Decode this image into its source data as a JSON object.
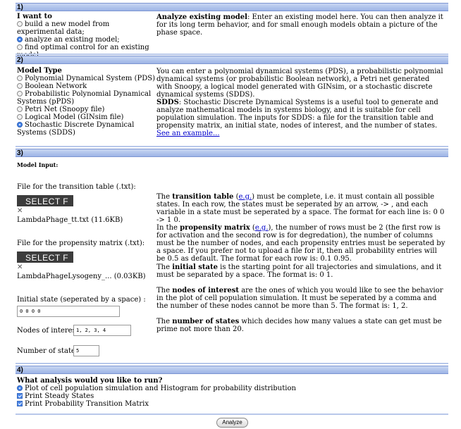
{
  "section1": {
    "num": "1)",
    "heading": "I want to",
    "options": [
      {
        "label": "build a new model from experimental data;",
        "selected": false
      },
      {
        "label": "analyze an existing model;",
        "selected": true
      },
      {
        "label": "find optimal control for an existing model.",
        "selected": false
      }
    ],
    "desc_bold": "Analyze existing model",
    "desc_text": ": Enter an existing model here. You can then analyze it for its long term behavior, and for small enough models obtain a picture of the phase space."
  },
  "section2": {
    "num": "2)",
    "heading": "Model Type",
    "options": [
      {
        "label": "Polynomial Dynamical System (PDS)",
        "selected": false
      },
      {
        "label": "Boolean Network",
        "selected": false
      },
      {
        "label": "Probabilistic Polynomial Dynamical Systems (pPDS)",
        "selected": false
      },
      {
        "label": "Petri Net (Snoopy file)",
        "selected": false
      },
      {
        "label": "Logical Model (GINsim file)",
        "selected": false
      },
      {
        "label": "Stochastic Discrete Dynamical Systems (SDDS)",
        "selected": true
      }
    ],
    "desc1": "You can enter a polynomial dynamical systems (PDS), a probabilistic polynomial dynamical systems (or probabilistic Boolean network), a Petri net generated with Snoopy, a logical model generated with GINsim, or a stochastic discrete dynamical systems (SDDS).",
    "desc2_bold": "SDDS",
    "desc2_text": ": Stochastic Discrete Dynamical Systems is a useful tool to generate and analyze mathematical models in systems biology, and it is suitable for cell population simulation. The inputs for SDDS: a file for the transition table and propensity matrix, an initial state, nodes of interest, and the number of states.",
    "example_link": "See an example..."
  },
  "section3": {
    "num": "3)",
    "heading": "Model Input:",
    "transition_label": "File for the transition table (.txt):",
    "select_label": "SELECT F",
    "transition_file": "LambdaPhage_tt.txt (11.6KB)",
    "propensity_label": "File for the propensity matrix (.txt):",
    "propensity_file": "LambdaPhageLysogeny_... (0.03KB)",
    "initial_label": "Initial state (seperated by a space) :",
    "initial_value": "0 0 0 0",
    "nodes_label": "Nodes of interest :",
    "nodes_value": "1, 2, 3, 4",
    "states_label": "Number of states :",
    "states_value": "5",
    "eg": "e.g.",
    "tt_pre": "The ",
    "tt_bold": "transition table",
    "tt_mid": " (",
    "tt_post": ") must be complete, i.e. it must contain all possible states. In each row, the states must be seperated by an arrow, -> , and each variable in a state must be seperated by a space. The format for each line is: 0 0 -> 1 0.",
    "pm_pre": "In the ",
    "pm_bold": "propensity matrix",
    "pm_mid": " (",
    "pm_post": "), the number of rows must be 2 (the first row is for activation and the second row is for degredation), the number of columns must be the number of nodes, and each propensity entries must be seperated by a space. If you prefer not to upload a file for it, then all probability entries will be 0.5 as default. The format for each row is: 0.1 0.95.",
    "is_pre": "The ",
    "is_bold": "initial state",
    "is_post": " is the starting point for all trajectories and simulations, and it must be separated by a space. The format is: 0 1.",
    "ni_pre": "The ",
    "ni_bold": "nodes of interest",
    "ni_post": " are the ones of which you would like to see the behavior in the plot of cell population simulation. It must be seperated by a comma and the number of these nodes cannot be more than 5. The format is: 1, 2.",
    "ns_pre": "The ",
    "ns_bold": "number of states",
    "ns_post": " which decides how many values a state can get must be prime not more than 20."
  },
  "section4": {
    "num": "4)",
    "heading": "What analysis would you like to run?",
    "options": [
      {
        "label": "Plot of cell population simulation and Histogram for probability distribution",
        "kind": "radio",
        "selected": true
      },
      {
        "label": "Print Steady States",
        "kind": "check",
        "selected": true
      },
      {
        "label": "Print Probability Transition Matrix",
        "kind": "check",
        "selected": true
      }
    ]
  },
  "analyze_label": "Analyze"
}
